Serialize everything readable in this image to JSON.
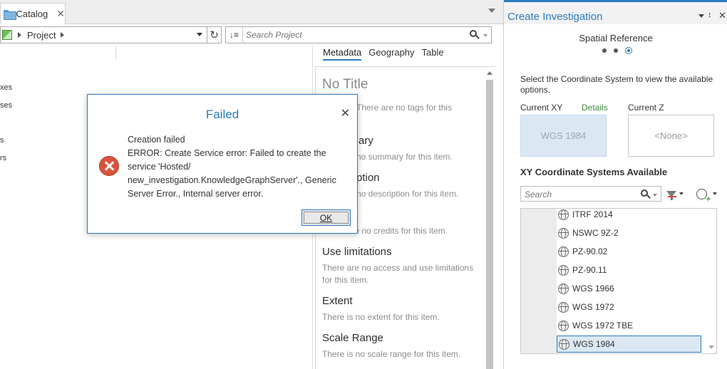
{
  "catalog": {
    "tab_label": "Catalog",
    "tab_close": "✕",
    "breadcrumb": {
      "project": "Project"
    },
    "refresh_glyph": "↻",
    "sort_glyph": "↓≡",
    "search_placeholder": "Search Project",
    "tree_fragments": [
      "xes",
      "ses",
      "s",
      "rs"
    ]
  },
  "metadata": {
    "tabs": [
      "Metadata",
      "Geography",
      "Table"
    ],
    "no_title": "No Title",
    "tags_text": "There are no tags for this",
    "summary_head": "ary",
    "summary_text": "no summary for this item.",
    "description_head": "ption",
    "description_text": "no description for this item.",
    "credits_text": "There are no credits for this item.",
    "use_limitations_head": "Use limitations",
    "use_limitations_text": "There are no access and use limitations for this item.",
    "extent_head": "Extent",
    "extent_text": "There is no extent for this item.",
    "scale_range_head": "Scale Range",
    "scale_range_text": "There is no scale range for this item."
  },
  "dialog": {
    "title": "Failed",
    "close_glyph": "✕",
    "message_lines": [
      "Creation failed",
      "ERROR: Create Service error: Failed to create the",
      "service 'Hosted/",
      "new_investigation.KnowledgeGraphServer'., Generic",
      "Server Error., Internal server error."
    ],
    "ok_label": "OK"
  },
  "create_investigation": {
    "title": "Create Investigation",
    "pin_glyph": "📌",
    "close_glyph": "✕",
    "step_title": "Spatial Reference",
    "step_current": 3,
    "step_total": 3,
    "instruction": "Select the Coordinate System to view the available options.",
    "current_xy_label": "Current XY",
    "details_link": "Details",
    "current_z_label": "Current Z",
    "current_xy_value": "WGS 1984",
    "current_z_value": "<None>",
    "available_head": "XY Coordinate Systems Available",
    "search_placeholder": "Search",
    "coordinate_systems": [
      "ITRF 2014",
      "NSWC 9Z-2",
      "PZ-90.02",
      "PZ-90.11",
      "WGS 1966",
      "WGS 1972",
      "WGS 1972 TBE",
      "WGS 1984"
    ],
    "selected": "WGS 1984"
  },
  "colors": {
    "accent": "#2b7bbf",
    "error": "#d9533c",
    "details_link": "#3f8a3f",
    "selection": "#dbe8f4"
  }
}
